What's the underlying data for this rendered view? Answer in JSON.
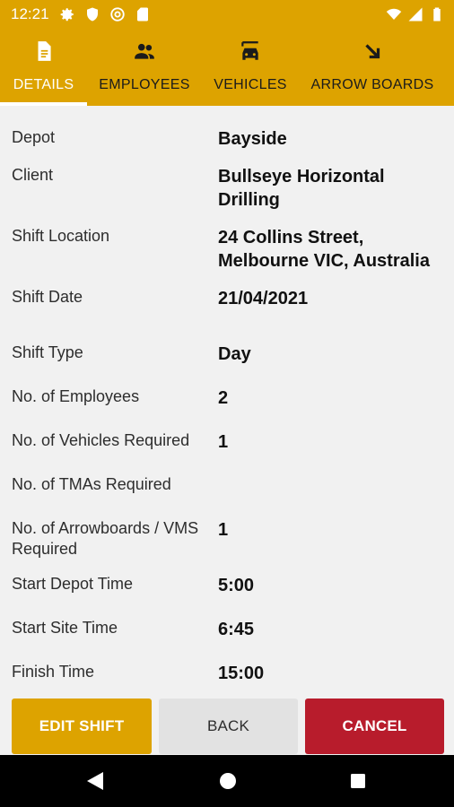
{
  "status_bar": {
    "time": "12:21",
    "left_icons": [
      "gear-icon",
      "shield-icon",
      "at-icon",
      "sim-icon"
    ],
    "right_icons": [
      "wifi-icon",
      "signal-icon",
      "battery-icon"
    ]
  },
  "tabs": [
    {
      "label": "DETAILS",
      "icon": "document-icon",
      "active": true
    },
    {
      "label": "EMPLOYEES",
      "icon": "people-icon",
      "active": false
    },
    {
      "label": "VEHICLES",
      "icon": "car-icon",
      "active": false
    },
    {
      "label": "ARROW BOARDS",
      "icon": "arrow-down-right-icon",
      "active": false
    }
  ],
  "details": [
    {
      "label": "Depot",
      "value": "Bayside"
    },
    {
      "label": "Client",
      "value": "Bullseye Horizontal Drilling"
    },
    {
      "label": "Shift Location",
      "value": "24 Collins Street, Melbourne VIC, Australia"
    },
    {
      "label": "Shift Date",
      "value": "21/04/2021"
    },
    {
      "label": "Shift Type",
      "value": "Day"
    },
    {
      "label": "No. of Employees",
      "value": "2"
    },
    {
      "label": "No. of Vehicles Required",
      "value": "1"
    },
    {
      "label": "No. of TMAs Required",
      "value": ""
    },
    {
      "label": "No. of Arrowboards / VMS Required",
      "value": "1"
    },
    {
      "label": "Start Depot Time",
      "value": "5:00"
    },
    {
      "label": "Start Site Time",
      "value": "6:45"
    },
    {
      "label": "Finish Time",
      "value": "15:00"
    }
  ],
  "buttons": {
    "edit": "EDIT SHIFT",
    "back": "BACK",
    "cancel": "CANCEL"
  },
  "colors": {
    "primary": "#dda300",
    "cancel": "#b81c2c",
    "secondary": "#e2e2e2"
  }
}
